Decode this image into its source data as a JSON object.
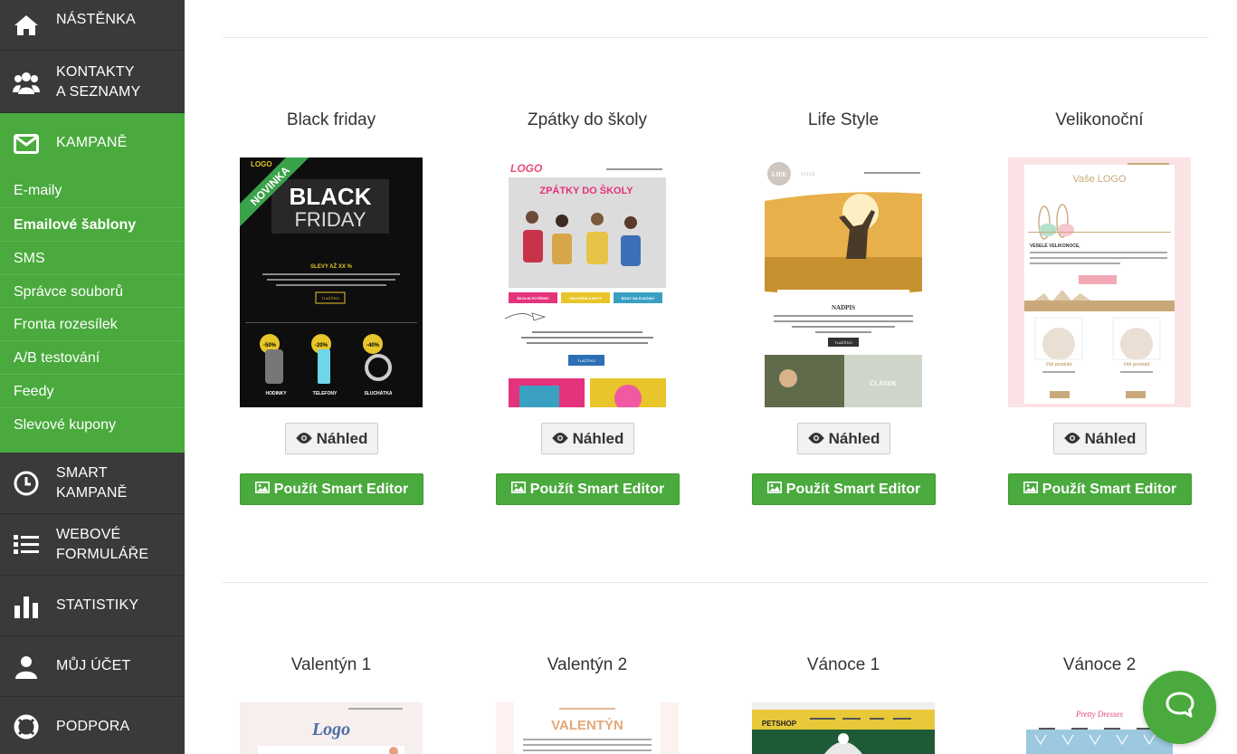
{
  "sidebar": {
    "nav": [
      {
        "label": "NÁSTĚNKA",
        "icon": "home-icon"
      },
      {
        "label": "KONTAKTY",
        "label2": "A SEZNAMY",
        "icon": "users-icon"
      },
      {
        "label": "KAMPANĚ",
        "icon": "envelope-icon"
      },
      {
        "label": "SMART",
        "label2": "KAMPANĚ",
        "icon": "clock-icon"
      },
      {
        "label": "WEBOVÉ",
        "label2": "FORMULÁŘE",
        "icon": "list-icon"
      },
      {
        "label": "STATISTIKY",
        "icon": "bar-chart-icon"
      },
      {
        "label": "MŮJ ÚČET",
        "icon": "user-icon"
      },
      {
        "label": "PODPORA",
        "icon": "lifebuoy-icon"
      }
    ],
    "submenu": [
      "E-maily",
      "Emailové šablony",
      "SMS",
      "Správce souborů",
      "Fronta rozesílek",
      "A/B testování",
      "Feedy",
      "Slevové kupony"
    ],
    "active_nav": "KAMPANĚ",
    "current_submenu": "Emailové šablony"
  },
  "templates": {
    "preview_label": "Náhled",
    "smart_label": "Použít Smart Editor",
    "row1": [
      {
        "title": "Black friday"
      },
      {
        "title": "Zpátky do školy"
      },
      {
        "title": "Life Style"
      },
      {
        "title": "Velikonoční"
      }
    ],
    "row2": [
      {
        "title": "Valentýn 1"
      },
      {
        "title": "Valentýn 2"
      },
      {
        "title": "Vánoce 1"
      },
      {
        "title": "Vánoce 2"
      }
    ]
  },
  "thumbs": {
    "bf_logo": "LOGO",
    "bf_ribbon": "NOVINKA",
    "bf_black": "BLACK",
    "bf_friday": "FRIDAY",
    "bf_slevy": "SLEVY AŽ XX %",
    "bf_btn": "TLAČÍTKO",
    "bf_badges": [
      "-50%",
      "-20%",
      "-40%"
    ],
    "bf_products": [
      "HODINKY",
      "TELEFONY",
      "SLUCHÁTKA"
    ],
    "school_logo": "LOGO",
    "school_title": "ZPÁTKY DO ŠKOLY",
    "school_pills": [
      "ŠKOLNÍ POTŘEBY",
      "OBLEČENÍ A BOTY",
      "BOXY NA SVAČINY"
    ],
    "school_btn": "TLAČÍTKO",
    "life_logo": "LIFE",
    "life_logo_small": "STYLE",
    "life_heading": "NADPIS",
    "life_btn": "TLAČÍTKO",
    "life_article": "ČLÁNEK",
    "easter_logo": "Vaše LOGO",
    "easter_greeting": "VESELÉ VELIKONOCE,",
    "easter_product": "Váš produkt",
    "val1_logo": "Logo",
    "val2_title": "VALENTÝN",
    "xmas1_brand": "PETSHOP",
    "xmas2_brand": "Pretty Dresses"
  },
  "colors": {
    "sidebar_bg": "#3a3a3a",
    "accent_green": "#4aaa3d"
  }
}
